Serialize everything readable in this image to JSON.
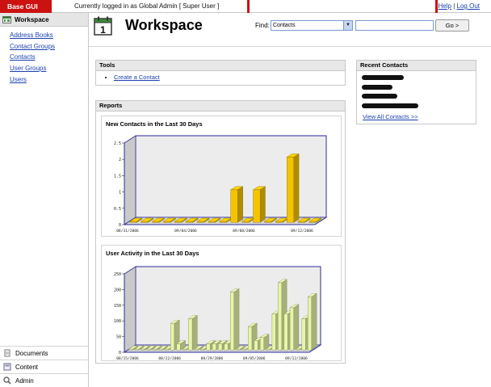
{
  "topbar": {
    "brand": "Base GUI",
    "login_message": "Currently logged in as Global Admin [ Super User ]",
    "help": "Help",
    "separator": "|",
    "logout": "Log Out"
  },
  "sidebar": {
    "section_title": "Workspace",
    "links": [
      "Address Books",
      "Contact Groups",
      "Contacts",
      "User Groups",
      "Users"
    ],
    "bottom": [
      {
        "label": "Documents",
        "icon": "documents-icon"
      },
      {
        "label": "Content",
        "icon": "content-icon"
      },
      {
        "label": "Admin",
        "icon": "admin-icon"
      }
    ]
  },
  "header": {
    "title": "Workspace",
    "calendar_day": "1",
    "find_label": "Find:",
    "find_selected": "Contacts",
    "search_value": "",
    "go_label": "Go >"
  },
  "tools": {
    "title": "Tools",
    "items": [
      "Create a Contact"
    ]
  },
  "recent": {
    "title": "Recent Contacts",
    "view_all": "View All Contacts >>"
  },
  "reports": {
    "title": "Reports"
  },
  "colors": {
    "brand_red": "#cc1111",
    "bar_yellow": "#f5c400",
    "bar_light_green": "#e6f5a8",
    "chart_axis_blue": "#2a2a9a"
  },
  "chart_data": [
    {
      "type": "bar",
      "title": "New Contacts in the Last 30 Days",
      "y_ticks": [
        "0",
        "0.5",
        "1",
        "1.5",
        "2",
        "2.5"
      ],
      "ylim": [
        0,
        2.5
      ],
      "x_tick_labels": [
        "08/31/2006",
        "09/04/2006",
        "09/08/2006",
        "09/12/2006"
      ],
      "values": [
        0,
        0,
        0,
        0,
        0,
        0,
        0,
        0,
        0,
        1,
        0,
        1,
        0,
        0,
        2,
        0,
        0
      ]
    },
    {
      "type": "bar",
      "title": "User Activity in the Last 30 Days",
      "y_ticks": [
        "0",
        "50",
        "100",
        "150",
        "200",
        "250"
      ],
      "ylim": [
        0,
        250
      ],
      "x_tick_labels": [
        "08/15/2006",
        "08/22/2006",
        "08/29/2006",
        "09/05/2006",
        "09/12/2006"
      ],
      "values": [
        0,
        0,
        0,
        0,
        0,
        0,
        0,
        85,
        20,
        0,
        100,
        0,
        0,
        20,
        20,
        20,
        20,
        185,
        0,
        0,
        75,
        30,
        40,
        0,
        115,
        215,
        115,
        135,
        0,
        100,
        170
      ]
    }
  ]
}
